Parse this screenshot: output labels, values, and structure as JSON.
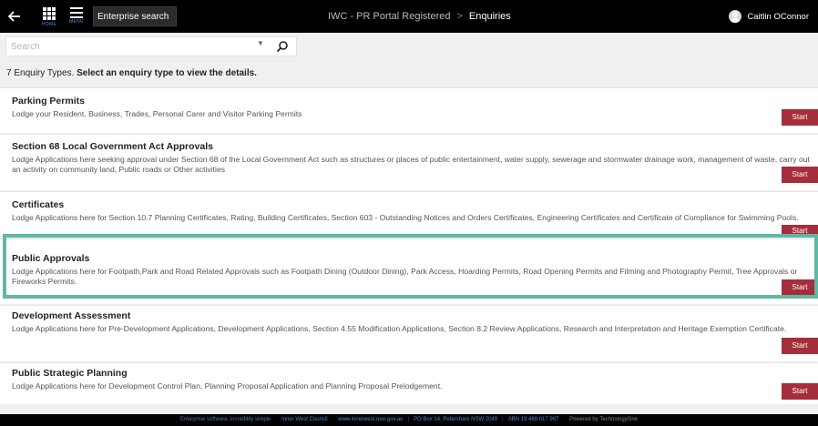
{
  "topbar": {
    "home_label": "HOME",
    "menu_label": "MENU",
    "search_text": "Enterprise search",
    "breadcrumb_root": "IWC - PR Portal Registered",
    "breadcrumb_separator": ">",
    "breadcrumb_current": "Enquiries",
    "user_name": "Caitlin OConnor"
  },
  "search": {
    "placeholder": "Search",
    "value": ""
  },
  "summary": {
    "count_text": "7 Enquiry Types.",
    "instruction": "Select an enquiry type to view the details."
  },
  "enquiries": [
    {
      "title": "Parking Permits",
      "description": "Lodge your Resident, Business, Trades, Personal Carer and Visitor Parking Permits",
      "button": "Start"
    },
    {
      "title": "Section 68 Local Government Act Approvals",
      "description": "Lodge Applications here seeking approval under Section 68 of the Local Government Act such as structures or places of public entertainment, water supply, sewerage and stormwater drainage work, management of waste, carry out an activity on community land, Public roads or Other activities",
      "button": "Start"
    },
    {
      "title": "Certificates",
      "description": "Lodge Applications here for Section 10.7 Planning Certificates, Rating, Building Certificates, Section 603 - Outstanding Notices and Orders Certificates, Engineering Certificates and Certificate of Compliance for Swimming Pools.",
      "button": "Start"
    },
    {
      "title": "Public Approvals",
      "description": "Lodge Applications here for Footpath,Park and Road Related Approvals such as Footpath Dining (Outdoor Dining), Park Access, Hoarding Permits, Road Opening Permits and Filming and Photography Permit, Tree Approvals or Fireworks Permits.",
      "button": "Start"
    },
    {
      "title": "Development Assessment",
      "description": "Lodge Applications here for Pre-Development Applications, Development Applications, Section 4.55 Modification Applications, Section 8.2 Review Applications, Research and Interpretation and Heritage Exemption Certificate.",
      "button": "Start"
    },
    {
      "title": "Public Strategic Planning",
      "description": "Lodge Applications here for Development Control Plan, Planning Proposal Application and Planning Proposal Prelodgement.",
      "button": "Start"
    }
  ],
  "footer": {
    "tagline": "Enterprise software, incredibly simple",
    "council": "Inner West Council",
    "website": "www.innerwest.nsw.gov.au",
    "address": "PO Box 14, Petersham NSW 2049",
    "abn": "ABN 19 488 017 987",
    "powered_by": "Powered by TechnologyOne"
  },
  "colors": {
    "topbar_bg": "#000000",
    "start_button": "#a62e3b",
    "highlight_border": "#5fb8a3",
    "page_bg": "#f0f0f0"
  },
  "icons": [
    "back-arrow-icon",
    "home-grid-icon",
    "menu-icon",
    "chevron-down-icon",
    "search-icon",
    "user-avatar-icon"
  ]
}
